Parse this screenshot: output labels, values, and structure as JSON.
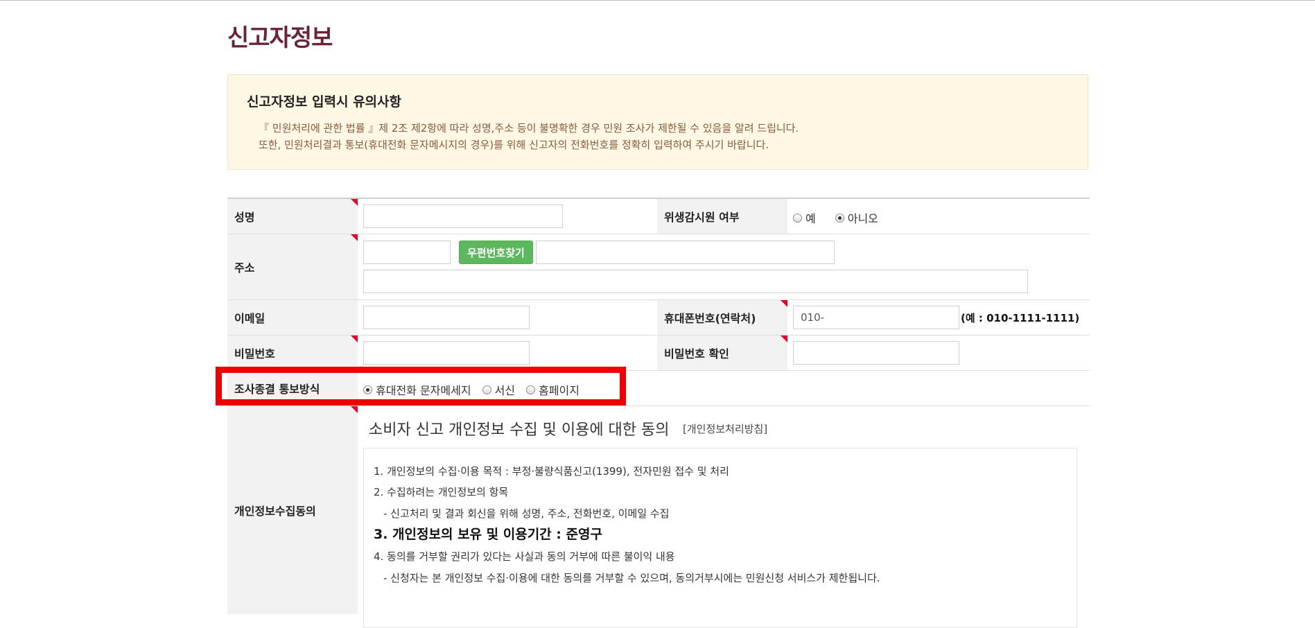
{
  "page": {
    "title": "신고자정보"
  },
  "notice": {
    "title": "신고자정보 입력시 유의사항",
    "lines": [
      "『 민원처리에 관한 법률 』제 2조 제2항에 따라 성명,주소 등이 불명확한 경우 민원 조사가 제한될 수 있음을 알려 드립니다.",
      "또한, 민원처리결과 통보(휴대전화 문자메시지의 경우)를 위해 신고자의 전화번호를 정확히 입력하여 주시기 바랍니다."
    ]
  },
  "form": {
    "name": {
      "label": "성명",
      "value": ""
    },
    "inspector": {
      "label": "위생감시원 여부",
      "options": [
        "예",
        "아니오"
      ],
      "selected": "아니오"
    },
    "address": {
      "label": "주소",
      "zip_value": "",
      "zip_button": "우편번호찾기",
      "addr1_value": "",
      "addr2_value": ""
    },
    "email": {
      "label": "이메일",
      "value": ""
    },
    "mobile": {
      "label": "휴대폰번호(연락처)",
      "value": "010-",
      "hint": "(예 : 010-1111-1111)"
    },
    "password": {
      "label": "비밀번호",
      "value": ""
    },
    "password_confirm": {
      "label": "비밀번호 확인",
      "value": ""
    },
    "notify_method": {
      "label": "조사종결 통보방식",
      "options": [
        "휴대전화 문자메세지",
        "서신",
        "홈페이지"
      ],
      "selected": "휴대전화 문자메세지"
    },
    "privacy": {
      "label": "개인정보수집동의",
      "heading": "소비자 신고 개인정보 수집 및 이용에 대한 동의",
      "policy_link": "[개인정보처리방침]",
      "items": [
        "1. 개인정보의 수집·이용 목적 : 부정·불량식품신고(1399), 전자민원 접수 및 처리",
        "2. 수집하려는 개인정보의 항목",
        "- 신고처리 및 결과 회신을 위해 성명, 주소, 전화번호, 이메일 수집",
        "3. 개인정보의 보유 및 이용기간 : 준영구",
        "4. 동의를 거부할 권리가 있다는 사실과 동의 거부에 따른 불이익 내용",
        "- 신청자는 본 개인정보 수집·이용에 대한 동의를 거부할 수 있으며, 동의거부시에는 민원신청 서비스가 제한됩니다."
      ]
    }
  },
  "colors": {
    "title": "#6b2435",
    "notice_bg": "#fdf7e4",
    "notice_text": "#8a5a3e",
    "required_marker": "#e8002a",
    "zip_button": "#5cb85c",
    "highlight": "#ee0000"
  }
}
